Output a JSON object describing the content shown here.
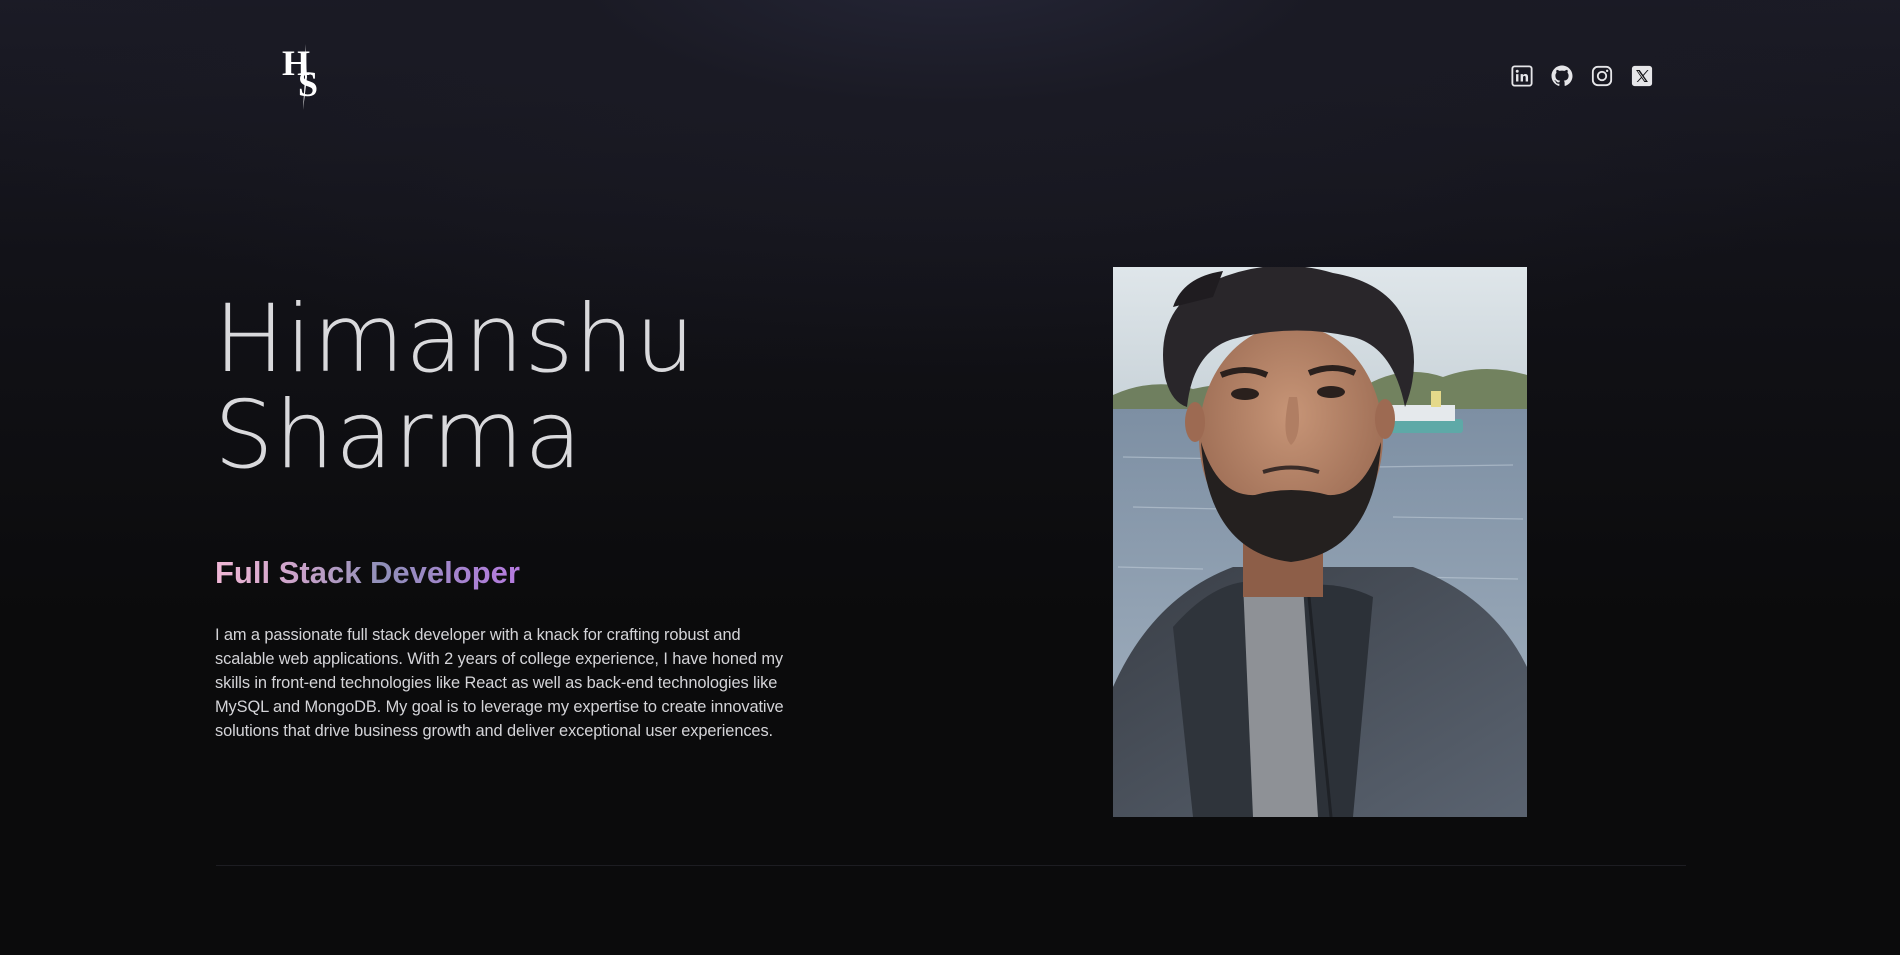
{
  "header": {
    "logo_text": "HS",
    "social_links": [
      {
        "name": "linkedin",
        "icon": "linkedin-icon"
      },
      {
        "name": "github",
        "icon": "github-icon"
      },
      {
        "name": "instagram",
        "icon": "instagram-icon"
      },
      {
        "name": "x",
        "icon": "x-icon"
      }
    ]
  },
  "hero": {
    "first_name": "Himanshu",
    "last_name": "Sharma",
    "role": "Full Stack Developer",
    "bio": "I am a passionate full stack developer with a knack for crafting robust and scalable web applications. With 2 years of college experience, I have honed my skills in front-end technologies like React as well as back-end technologies like MySQL and MongoDB. My goal is to leverage my expertise to create innovative solutions that drive business growth and deliver exceptional user experiences."
  },
  "colors": {
    "background": "#0b0b0c",
    "header_glow": "#252637",
    "name_text": "#d9d9dc",
    "role_gradient": [
      "#f1b8d6",
      "#8f8fb8",
      "#b77be0"
    ],
    "bio_text": "#d4d4d8",
    "divider": "#1d1d22"
  }
}
